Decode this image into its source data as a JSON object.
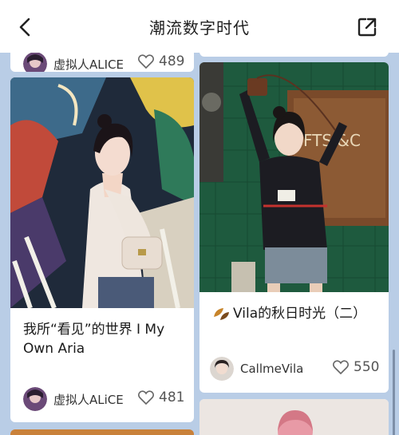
{
  "header": {
    "title": "潮流数字时代",
    "back_icon": "chevron-left-icon",
    "share_icon": "share-external-icon"
  },
  "cards": [
    {
      "author": "虚拟人ALICE",
      "likes": "489"
    },
    {
      "title": "我所“看见”的世界 I My Own Aria",
      "author": "虚拟人ALiCE",
      "likes": "481"
    },
    {
      "title_icon": "autumn-leaf-icon",
      "title": "Vila的秋日时光（二）",
      "author": "CallmeVila",
      "likes": "550"
    }
  ],
  "colors": {
    "feed_background": "#b9cde6",
    "card_background": "#ffffff"
  }
}
